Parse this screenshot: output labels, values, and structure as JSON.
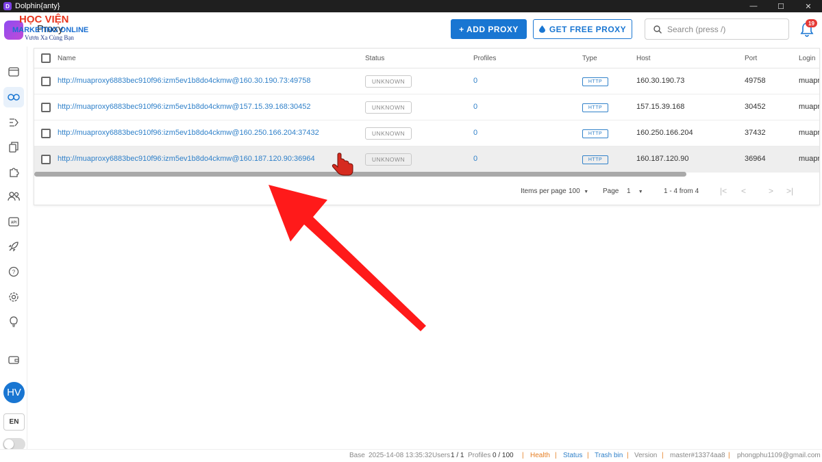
{
  "window": {
    "title": "Dolphin{anty}",
    "controls": {
      "minimize": "—",
      "maximize": "☐",
      "close": "✕"
    }
  },
  "watermark": {
    "line1": "HỌC VIỆN",
    "line2": "MARKETING ONLINE",
    "line3": "Vươn Xa Cùng Bạn"
  },
  "header": {
    "title": "Proxy",
    "add_proxy": "+ ADD PROXY",
    "get_free_proxy": "GET FREE PROXY",
    "search_placeholder": "Search (press /)",
    "notification_count": "19"
  },
  "sidebar": {
    "items": [
      "browser-icon",
      "link-icon",
      "automation-icon",
      "copy-icon",
      "puzzle-icon",
      "users-icon",
      "api-icon",
      "rocket-icon",
      "help-icon",
      "settings-icon",
      "bulb-icon",
      "wallet-icon"
    ],
    "active": "link-icon",
    "avatar": "HV",
    "language": "EN"
  },
  "table": {
    "columns": [
      "Name",
      "Status",
      "Profiles",
      "Type",
      "Host",
      "Port",
      "Login"
    ],
    "rows": [
      {
        "name": "http://muaproxy6883bec910f96:izm5ev1b8do4ckmw@160.30.190.73:49758",
        "status": "UNKNOWN",
        "profiles": "0",
        "type": "HTTP",
        "host": "160.30.190.73",
        "port": "49758",
        "login": "muapr"
      },
      {
        "name": "http://muaproxy6883bec910f96:izm5ev1b8do4ckmw@157.15.39.168:30452",
        "status": "UNKNOWN",
        "profiles": "0",
        "type": "HTTP",
        "host": "157.15.39.168",
        "port": "30452",
        "login": "muapr"
      },
      {
        "name": "http://muaproxy6883bec910f96:izm5ev1b8do4ckmw@160.250.166.204:37432",
        "status": "UNKNOWN",
        "profiles": "0",
        "type": "HTTP",
        "host": "160.250.166.204",
        "port": "37432",
        "login": "muapr"
      },
      {
        "name": "http://muaproxy6883bec910f96:izm5ev1b8do4ckmw@160.187.120.90:36964",
        "status": "UNKNOWN",
        "profiles": "0",
        "type": "HTTP",
        "host": "160.187.120.90",
        "port": "36964",
        "login": "muapr"
      }
    ]
  },
  "pagination": {
    "items_per_page_label": "Items per page",
    "items_per_page": "100",
    "page_label": "Page",
    "page": "1",
    "range": "1 - 4 from 4",
    "first": "|<",
    "prev": "<",
    "next": ">",
    "last": ">|"
  },
  "statusbar": {
    "base": "Base",
    "datetime": "2025-14-08 13:35:32",
    "users_label": "Users",
    "users": "1 / 1",
    "profiles_label": "Profiles",
    "profiles": "0 / 100",
    "health": "Health",
    "status": "Status",
    "trash": "Trash bin",
    "version_label": "Version",
    "version": "master#13374aa8",
    "email": "phongphu1109@gmail.com"
  },
  "colors": {
    "accent": "#1976d2",
    "link": "#2f80c9",
    "annotation_arrow": "#ff1a1a",
    "badge": "#e53935"
  }
}
